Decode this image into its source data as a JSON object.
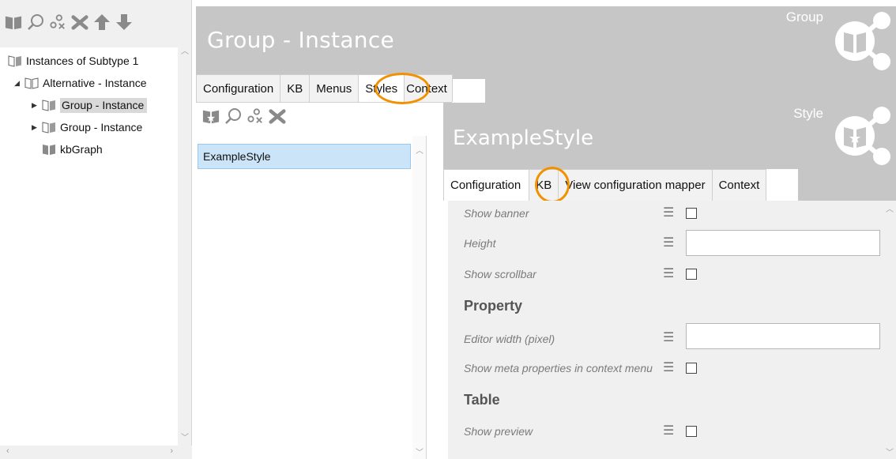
{
  "colors": {
    "highlight": "#f29100",
    "header_bg": "#c6c6c6",
    "selection": "#cce4f7"
  },
  "left_toolbar": {
    "icons": [
      "book-icon",
      "search-icon",
      "unlink-icon",
      "delete-icon",
      "move-up-icon",
      "move-down-icon"
    ]
  },
  "tree": {
    "items": [
      {
        "label": "Instances of Subtype 1",
        "icon": "book-outline-icon",
        "level": 0,
        "expanded": null
      },
      {
        "label": "Alternative - Instance",
        "icon": "folder-outline-icon",
        "level": 1,
        "expanded": true
      },
      {
        "label": "Group - Instance",
        "icon": "book-outline-icon",
        "level": 2,
        "expanded": false,
        "selected": true
      },
      {
        "label": "Group - Instance",
        "icon": "book-outline-icon",
        "level": 2,
        "expanded": false
      },
      {
        "label": "kbGraph",
        "icon": "book-icon",
        "level": 2,
        "expanded": null
      }
    ]
  },
  "group": {
    "title": "Group - Instance",
    "kind": "Group",
    "tabs": [
      "Configuration",
      "KB",
      "Menus",
      "Styles",
      "Context"
    ],
    "active_tab": "Styles"
  },
  "styles_toolbar": {
    "icons": [
      "add-style-icon",
      "search-icon",
      "unlink-icon",
      "delete-icon"
    ]
  },
  "styles_list": {
    "items": [
      "ExampleStyle"
    ],
    "selected": "ExampleStyle"
  },
  "style": {
    "title": "ExampleStyle",
    "kind": "Style",
    "tabs": [
      "Configuration",
      "KB",
      "View configuration mapper",
      "Context"
    ],
    "active_tab": "Configuration"
  },
  "properties": {
    "show_banner": {
      "label": "Show banner",
      "checked": false
    },
    "height": {
      "label": "Height",
      "value": ""
    },
    "show_scrollbar": {
      "label": "Show scrollbar",
      "checked": false
    },
    "section_property": "Property",
    "editor_width": {
      "label": "Editor width (pixel)",
      "value": ""
    },
    "show_meta": {
      "label": "Show meta properties in context menu",
      "checked": false
    },
    "section_table": "Table",
    "show_preview": {
      "label": "Show preview",
      "checked": false
    }
  }
}
